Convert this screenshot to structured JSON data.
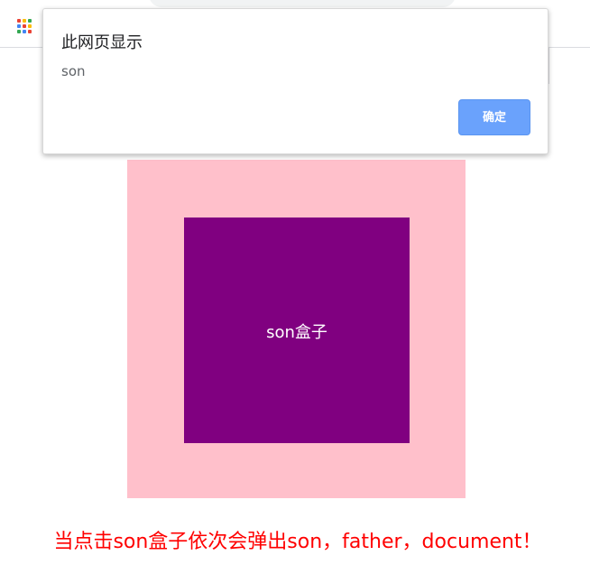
{
  "browser": {
    "apps_icon": "apps-grid-icon",
    "apps_icon_colors": [
      "#ea4335",
      "#fbbc04",
      "#34a853",
      "#4285f4",
      "#ea4335",
      "#fbbc04",
      "#34a853",
      "#4285f4",
      "#ea4335"
    ]
  },
  "dialog": {
    "title": "此网页显示",
    "message": "son",
    "ok_label": "确定"
  },
  "content": {
    "son_label": "son盒子",
    "caption": "当点击son盒子依次会弹出son，father，document！",
    "father_color": "#ffc0cb",
    "son_color": "#800080",
    "caption_color": "#ff0000"
  }
}
